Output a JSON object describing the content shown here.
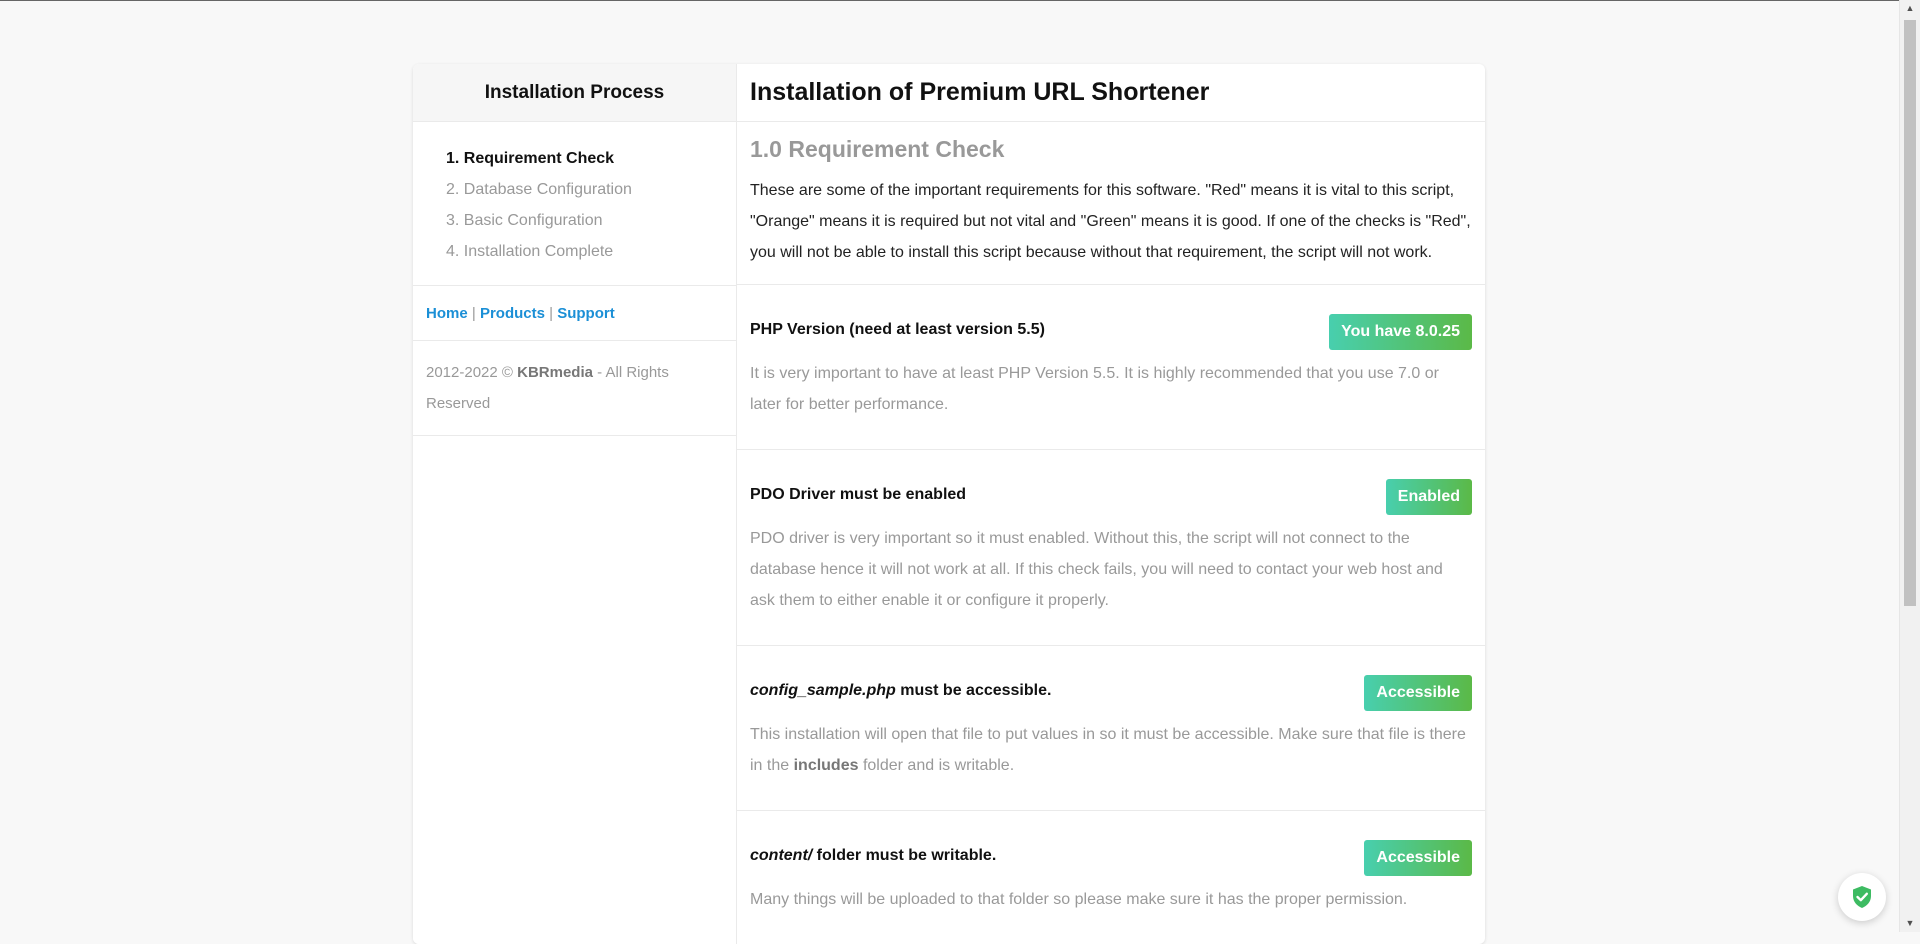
{
  "sidebar": {
    "title": "Installation Process",
    "steps": [
      "1. Requirement Check",
      "2. Database Configuration",
      "3. Basic Configuration",
      "4. Installation Complete"
    ],
    "links": {
      "home": "Home",
      "products": "Products",
      "support": "Support",
      "separator": "|"
    },
    "copyright": {
      "years": "2012-2022 ©",
      "brand": "KBRmedia",
      "suffix": "- All Rights Reserved"
    }
  },
  "main": {
    "title": "Installation of Premium URL Shortener",
    "section_title": "1.0 Requirement Check",
    "intro": "These are some of the important requirements for this software. \"Red\" means it is vital to this script, \"Orange\" means it is required but not vital and \"Green\" means it is good. If one of the checks is \"Red\", you will not be able to install this script because without that requirement, the script will not work.",
    "checks": [
      {
        "title": "PHP Version (need at least version 5.5)",
        "badge": "You have 8.0.25",
        "desc": "It is very important to have at least PHP Version 5.5. It is highly recommended that you use 7.0 or later for better performance."
      },
      {
        "title": "PDO Driver must be enabled",
        "badge": "Enabled",
        "desc": "PDO driver is very important so it must enabled. Without this, the script will not connect to the database hence it will not work at all. If this check fails, you will need to contact your web host and ask them to either enable it or configure it properly."
      },
      {
        "title_em": "config_sample.php",
        "title_rest": "must be accessible.",
        "badge": "Accessible",
        "desc_pre": "This installation will open that file to put values in so it must be accessible. Make sure that file is there in the",
        "desc_strong": "includes",
        "desc_post": "folder and is writable."
      },
      {
        "title_em": "content/",
        "title_rest": "folder must be writable.",
        "badge": "Accessible",
        "desc": "Many things will be uploaded to that folder so please make sure it has the proper permission."
      }
    ]
  },
  "colors": {
    "badge_gradient_start": "#48cfae",
    "badge_gradient_end": "#5bb947",
    "link": "#1b8fd6"
  },
  "icons": {
    "floating": "shield-check-icon"
  }
}
